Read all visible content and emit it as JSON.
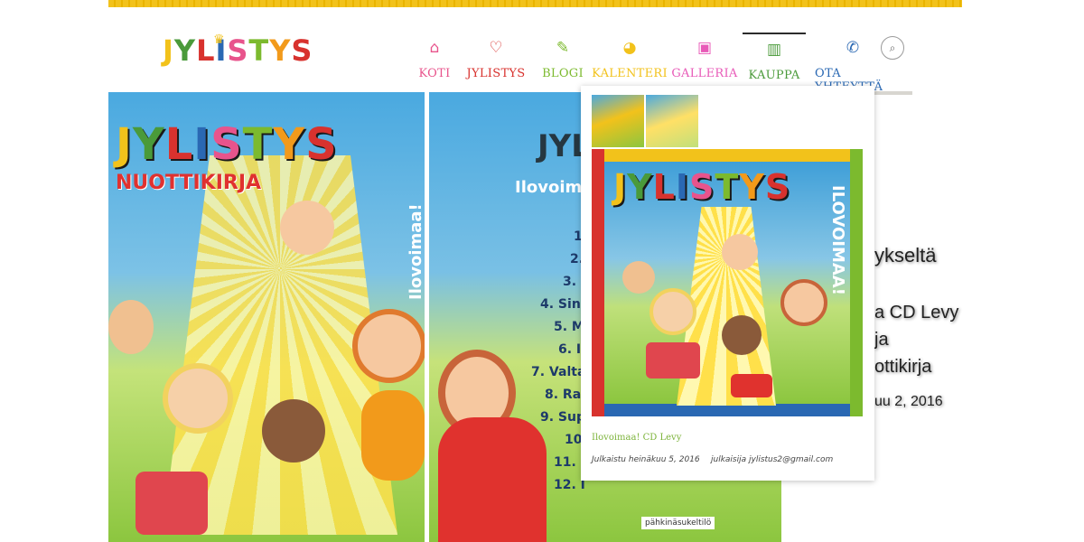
{
  "header": {
    "logo_text": [
      "J",
      "Y",
      "L",
      "I",
      "S",
      "T",
      "Y",
      "S"
    ],
    "logo_colors": [
      "#f2c21b",
      "#4a9a3a",
      "#d8322e",
      "#2a68b3",
      "#e8548c",
      "#7cba2e",
      "#f29a1b",
      "#d8322e"
    ]
  },
  "nav": {
    "items": [
      {
        "label": "KOTI",
        "icon": "⌂",
        "color": "#e8548c"
      },
      {
        "label": "JYLISTYS",
        "icon": "♡",
        "color": "#d8322e"
      },
      {
        "label": "BLOGI",
        "icon": "✎",
        "color": "#7cba2e"
      },
      {
        "label": "KALENTERI",
        "icon": "◕",
        "color": "#f2c21b"
      },
      {
        "label": "GALLERIA",
        "icon": "▣",
        "color": "#e85ab8"
      },
      {
        "label": "KAUPPA",
        "icon": "▥",
        "color": "#4a9a3a"
      },
      {
        "label": "OTA YHTEYTTÄ",
        "icon": "✆",
        "color": "#2a68b3"
      }
    ],
    "search_icon": "⌕"
  },
  "hero_left": {
    "title": "JYLISTYS",
    "subtitle": "NUOTTIKIRJA",
    "vertical_text": "Ilovoimaa!"
  },
  "hero_right": {
    "title": "JYL",
    "subtitle": "Ilovoimaa!",
    "tracks": [
      "1.",
      "2. I",
      "3. I",
      "4. Sinu",
      "5. M",
      "6. I",
      "7. Valtais",
      "8. Rak",
      "9. Sup",
      "10.",
      "11. S",
      "12. I"
    ],
    "publisher": "pähkinäsukeltilö"
  },
  "side_text": {
    "line1": "ykseltä",
    "line2": "a CD Levy",
    "line3": "ja",
    "line4": "ottikirja",
    "line5": "uu 2, 2016"
  },
  "dropdown": {
    "cover_title": "JYLISTYS",
    "cover_vertical": "ILOVOIMAA!",
    "post_title": "Ilovoimaa! CD Levy",
    "published": "Julkaistu heinäkuu 5, 2016",
    "author": "julkaisija jylistus2@gmail.com"
  }
}
